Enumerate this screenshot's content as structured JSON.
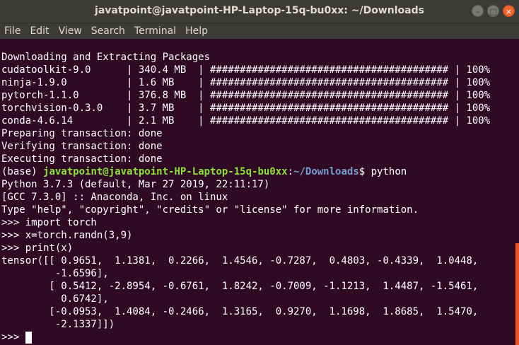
{
  "window": {
    "title": "javatpoint@javatpoint-HP-Laptop-15q-bu0xx: ~/Downloads",
    "buttons": {
      "minimize": "–",
      "maximize": "□",
      "close": "×"
    }
  },
  "menu": [
    "File",
    "Edit",
    "View",
    "Search",
    "Terminal",
    "Help"
  ],
  "terminal": {
    "header": "Downloading and Extracting Packages",
    "packages": [
      "cudatoolkit-9.0      | 340.4 MB  | ######################################## | 100%",
      "ninja-1.9.0          | 1.6 MB    | ######################################## | 100%",
      "pytorch-1.1.0        | 376.8 MB  | ######################################## | 100%",
      "torchvision-0.3.0    | 3.7 MB    | ######################################## | 100%",
      "conda-4.6.14         | 2.1 MB    | ######################################## | 100%"
    ],
    "transactions": [
      "Preparing transaction: done",
      "Verifying transaction: done",
      "Executing transaction: done"
    ],
    "prompt": {
      "env": "(base) ",
      "user_host": "javatpoint@javatpoint-HP-Laptop-15q-bu0xx",
      "colon": ":",
      "path": "~/Downloads",
      "dollar": "$ ",
      "command": "python"
    },
    "python_banner": [
      "Python 3.7.3 (default, Mar 27 2019, 22:11:17)",
      "[GCC 7.3.0] :: Anaconda, Inc. on linux",
      "Type \"help\", \"copyright\", \"credits\" or \"license\" for more information."
    ],
    "repl": [
      ">>> import torch",
      ">>> x=torch.randn(3,9)",
      ">>> print(x)"
    ],
    "output": [
      "tensor([[ 0.9651,  1.1381,  0.2266,  1.4546, -0.7287,  0.4803, -0.4339,  1.0448,",
      "         -1.6596],",
      "        [ 0.5412, -2.8954, -0.6761,  1.8242, -0.7009, -1.1213,  1.4487, -1.5461,",
      "          0.6742],",
      "        [-0.0953,  1.4084, -0.2466,  1.3165,  0.9270,  1.1698,  1.8685,  1.5470,",
      "         -2.1337]])"
    ],
    "final_prompt": ">>> ",
    "colors": {
      "background": "#300a24",
      "user_host": "#8ae234",
      "path": "#729fcf",
      "scrollbar": "#e95420"
    }
  }
}
